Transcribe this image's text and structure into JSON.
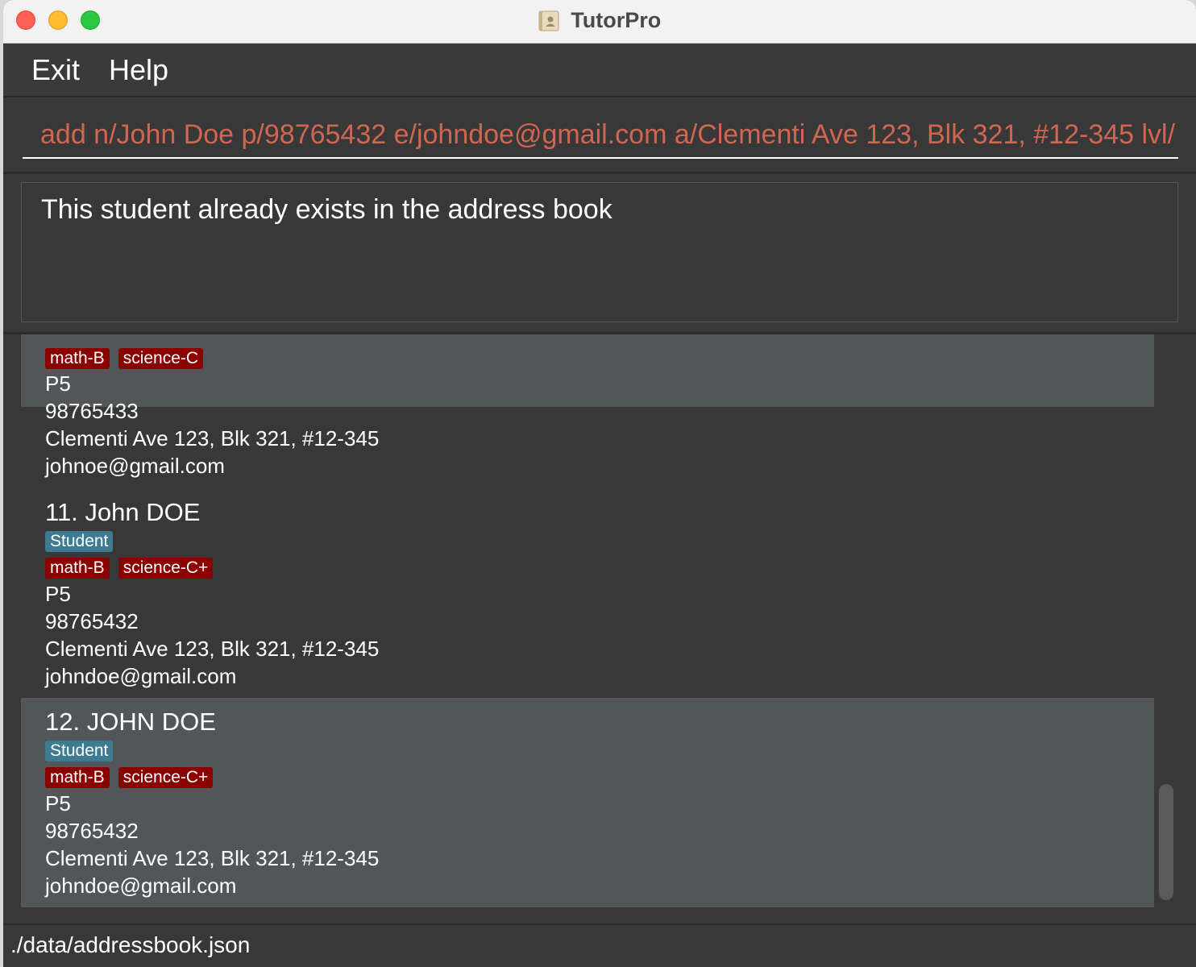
{
  "window": {
    "title": "TutorPro"
  },
  "menu": {
    "exit": "Exit",
    "help": "Help"
  },
  "command": {
    "value": "add n/John Doe p/98765432 e/johndoe@gmail.com a/Clementi Ave 123, Blk 321, #12-345 lvl/"
  },
  "result": {
    "message": "This student already exists in the address book"
  },
  "persons": [
    {
      "subjects": [
        "math-B",
        "science-C"
      ],
      "level": "P5",
      "phone": "98765433",
      "address": "Clementi Ave 123, Blk 321, #12-345",
      "email": "johnoe@gmail.com"
    },
    {
      "title": "11.  John DOE",
      "role": "Student",
      "subjects": [
        "math-B",
        "science-C+"
      ],
      "level": "P5",
      "phone": "98765432",
      "address": "Clementi Ave 123, Blk 321, #12-345",
      "email": "johndoe@gmail.com"
    },
    {
      "title": "12.  JOHN DOE",
      "role": "Student",
      "subjects": [
        "math-B",
        "science-C+"
      ],
      "level": "P5",
      "phone": "98765432",
      "address": "Clementi Ave 123, Blk 321, #12-345",
      "email": "johndoe@gmail.com"
    }
  ],
  "status": {
    "file_path": "./data/addressbook.json"
  },
  "colors": {
    "command_text": "#d06651",
    "role_tag": "#3e7b91",
    "subject_tag": "#8b0000"
  }
}
